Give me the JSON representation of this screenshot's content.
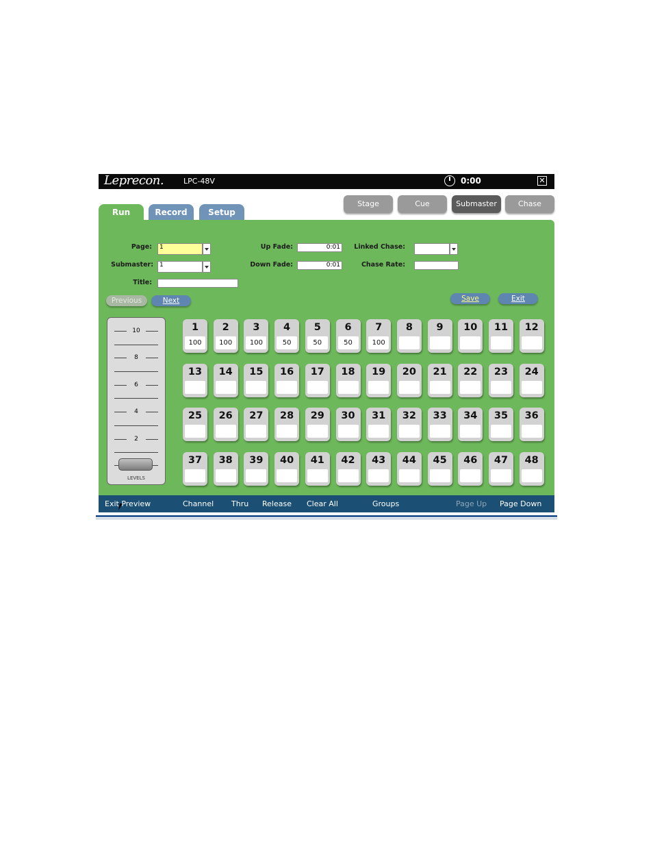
{
  "titlebar": {
    "logo": "Leprecon.",
    "model": "LPC-48V",
    "time": "0:00",
    "close_glyph": "✕"
  },
  "tabs": [
    {
      "label": "Run",
      "active": true
    },
    {
      "label": "Record",
      "active": false
    },
    {
      "label": "Setup",
      "active": false
    }
  ],
  "modes": [
    {
      "label": "Stage",
      "active": false
    },
    {
      "label": "Cue",
      "active": false
    },
    {
      "label": "Submaster",
      "active": true
    },
    {
      "label": "Chase",
      "active": false
    }
  ],
  "form": {
    "page_label": "Page:",
    "page_value": "1",
    "submaster_label": "Submaster:",
    "submaster_value": "1",
    "title_label": "Title:",
    "title_value": "",
    "up_fade_label": "Up Fade:",
    "up_fade_value": "0:01",
    "down_fade_label": "Down Fade:",
    "down_fade_value": "0:01",
    "linked_chase_label": "Linked Chase:",
    "linked_chase_value": "",
    "chase_rate_label": "Chase Rate:",
    "chase_rate_value": ""
  },
  "nav": {
    "previous": "Previous",
    "next": "Next",
    "save": "Save",
    "exit": "Exit"
  },
  "fader": {
    "label": "LEVELS",
    "scale": [
      "10",
      "8",
      "6",
      "4",
      "2"
    ],
    "level": 0
  },
  "channels": [
    {
      "n": "1",
      "v": "100"
    },
    {
      "n": "2",
      "v": "100"
    },
    {
      "n": "3",
      "v": "100"
    },
    {
      "n": "4",
      "v": "50"
    },
    {
      "n": "5",
      "v": "50"
    },
    {
      "n": "6",
      "v": "50"
    },
    {
      "n": "7",
      "v": "100"
    },
    {
      "n": "8",
      "v": ""
    },
    {
      "n": "9",
      "v": ""
    },
    {
      "n": "10",
      "v": ""
    },
    {
      "n": "11",
      "v": ""
    },
    {
      "n": "12",
      "v": ""
    },
    {
      "n": "13",
      "v": ""
    },
    {
      "n": "14",
      "v": ""
    },
    {
      "n": "15",
      "v": ""
    },
    {
      "n": "16",
      "v": ""
    },
    {
      "n": "17",
      "v": ""
    },
    {
      "n": "18",
      "v": ""
    },
    {
      "n": "19",
      "v": ""
    },
    {
      "n": "20",
      "v": ""
    },
    {
      "n": "21",
      "v": ""
    },
    {
      "n": "22",
      "v": ""
    },
    {
      "n": "23",
      "v": ""
    },
    {
      "n": "24",
      "v": ""
    },
    {
      "n": "25",
      "v": ""
    },
    {
      "n": "26",
      "v": ""
    },
    {
      "n": "27",
      "v": ""
    },
    {
      "n": "28",
      "v": ""
    },
    {
      "n": "29",
      "v": ""
    },
    {
      "n": "30",
      "v": ""
    },
    {
      "n": "31",
      "v": ""
    },
    {
      "n": "32",
      "v": ""
    },
    {
      "n": "33",
      "v": ""
    },
    {
      "n": "34",
      "v": ""
    },
    {
      "n": "35",
      "v": ""
    },
    {
      "n": "36",
      "v": ""
    },
    {
      "n": "37",
      "v": ""
    },
    {
      "n": "38",
      "v": ""
    },
    {
      "n": "39",
      "v": ""
    },
    {
      "n": "40",
      "v": ""
    },
    {
      "n": "41",
      "v": ""
    },
    {
      "n": "42",
      "v": ""
    },
    {
      "n": "43",
      "v": ""
    },
    {
      "n": "44",
      "v": ""
    },
    {
      "n": "45",
      "v": ""
    },
    {
      "n": "46",
      "v": ""
    },
    {
      "n": "47",
      "v": ""
    },
    {
      "n": "48",
      "v": ""
    }
  ],
  "bottombar": {
    "exit_preview": "Exit Preview",
    "channel": "Channel",
    "thru": "Thru",
    "release": "Release",
    "clear_all": "Clear All",
    "groups": "Groups",
    "page_up": "Page Up",
    "page_down": "Page Down"
  },
  "colors": {
    "panel": "#6db85a",
    "tab_inactive": "#6f94b8",
    "bottombar": "#1b4f73",
    "titlebar": "#0a0a0a"
  }
}
